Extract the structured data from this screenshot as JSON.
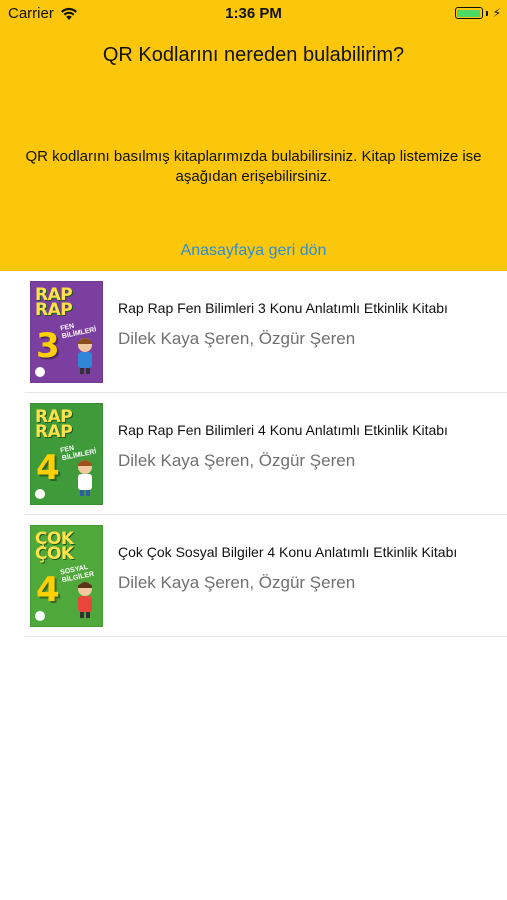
{
  "status_bar": {
    "carrier": "Carrier",
    "time": "1:36 PM",
    "battery_color": "#4cd964"
  },
  "header": {
    "background": "#FCC70B",
    "title": "QR Kodlarını nereden bulabilirim?",
    "body": "QR kodlarını basılmış kitaplarımızda bulabilirsiniz. Kitap listemize ise aşağıdan erişebilirsiniz.",
    "back_link": "Anasayfaya geri dön",
    "link_color": "#2A8FD6"
  },
  "books": [
    {
      "title": "Rap Rap Fen Bilimleri 3 Konu Anlatımlı Etkinlik Kitabı",
      "author": "Dilek Kaya Şeren, Özgür Şeren",
      "cover": {
        "title": "RAP RAP",
        "number": "3",
        "subtitle": "FEN BİLİMLERİ",
        "bg": "#7b3fa0"
      }
    },
    {
      "title": "Rap Rap Fen Bilimleri 4 Konu Anlatımlı Etkinlik Kitabı",
      "author": "Dilek Kaya Şeren, Özgür Şeren",
      "cover": {
        "title": "RAP RAP",
        "number": "4",
        "subtitle": "FEN BİLİMLERİ",
        "bg": "#3f9a3a"
      }
    },
    {
      "title": "Çok Çok Sosyal Bilgiler 4 Konu Anlatımlı Etkinlik Kitabı",
      "author": "Dilek Kaya Şeren, Özgür Şeren",
      "cover": {
        "title": "ÇOK ÇOK",
        "number": "4",
        "subtitle": "SOSYAL BİLGİLER",
        "bg": "#4fa83a"
      }
    }
  ]
}
